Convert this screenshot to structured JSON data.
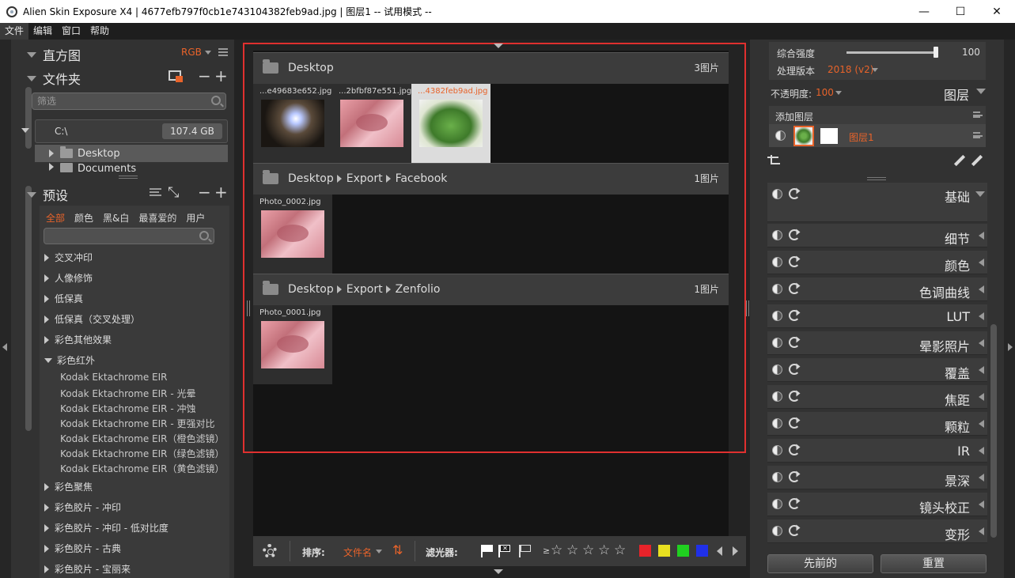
{
  "window": {
    "title": "Alien Skin Exposure X4 | 4677efb797f0cb1e743104382feb9ad.jpg | 图层1 -- 试用模式 --",
    "minimize": "—",
    "maximize": "☐",
    "close": "✕"
  },
  "menu": [
    "文件",
    "编辑",
    "窗口",
    "帮助"
  ],
  "left": {
    "histogram_title": "直方图",
    "histogram_mode": "RGB",
    "folders_title": "文件夹",
    "filter_placeholder": "筛选",
    "drive": {
      "label": "C:\\",
      "size": "107.4 GB"
    },
    "folders": [
      "Desktop",
      "Documents"
    ],
    "presets_title": "预设",
    "preset_tabs": [
      "全部",
      "颜色",
      "黑&白",
      "最喜爱的",
      "用户"
    ],
    "preset_groups": [
      "交叉冲印",
      "人像修饰",
      "低保真",
      "低保真（交叉处理）",
      "彩色其他效果",
      "彩色红外"
    ],
    "preset_sub_items": [
      "Kodak Ektachrome EIR",
      "Kodak Ektachrome EIR - 光晕",
      "Kodak Ektachrome EIR - 冲蚀",
      "Kodak Ektachrome EIR - 更强对比",
      "Kodak Ektachrome EIR（橙色滤镜）",
      "Kodak Ektachrome EIR（绿色滤镜）",
      "Kodak Ektachrome EIR（黄色滤镜）"
    ],
    "preset_groups_after": [
      "彩色聚焦",
      "彩色胶片 - 冲印",
      "彩色胶片 - 冲印 - 低对比度",
      "彩色胶片 - 古典",
      "彩色胶片 - 宝丽来"
    ]
  },
  "center": {
    "groups": [
      {
        "path": [
          "Desktop"
        ],
        "count": "3图片",
        "thumbs": [
          {
            "name": "...e49683e652.jpg",
            "img": "night",
            "selected": false
          },
          {
            "name": "...2bfbf87e551.jpg",
            "img": "dog",
            "selected": false
          },
          {
            "name": "...4382feb9ad.jpg",
            "img": "veg",
            "selected": true
          }
        ]
      },
      {
        "path": [
          "Desktop",
          "Export",
          "Facebook"
        ],
        "count": "1图片",
        "thumbs": [
          {
            "name": "Photo_0002.jpg",
            "img": "dog",
            "selected": false
          }
        ]
      },
      {
        "path": [
          "Desktop",
          "Export",
          "Zenfolio"
        ],
        "count": "1图片",
        "thumbs": [
          {
            "name": "Photo_0001.jpg",
            "img": "dog",
            "selected": false
          }
        ]
      }
    ],
    "toolbar": {
      "sort_label": "排序:",
      "sort_value": "文件名",
      "filter_label": "滤光器:",
      "gte": "≥",
      "star": "☆",
      "colors": [
        "#e8232a",
        "#e8e020",
        "#20d020",
        "#2030e8"
      ]
    }
  },
  "right": {
    "strength_label": "综合强度",
    "strength_value": "100",
    "strength_fraction": 0.96,
    "process_label": "处理版本",
    "process_value": "2018 (v2)",
    "opacity_label": "不透明度:",
    "opacity_value": "100",
    "layers_title": "图层",
    "add_layer": "添加图层",
    "layer_name": "图层1",
    "panels": [
      "基础",
      "细节",
      "颜色",
      "色调曲线",
      "LUT",
      "晕影照片",
      "覆盖",
      "焦距",
      "颗粒",
      "IR",
      "景深",
      "镜头校正",
      "变形"
    ],
    "btn_previous": "先前的",
    "btn_reset": "重置"
  },
  "accent": "#e8632a"
}
